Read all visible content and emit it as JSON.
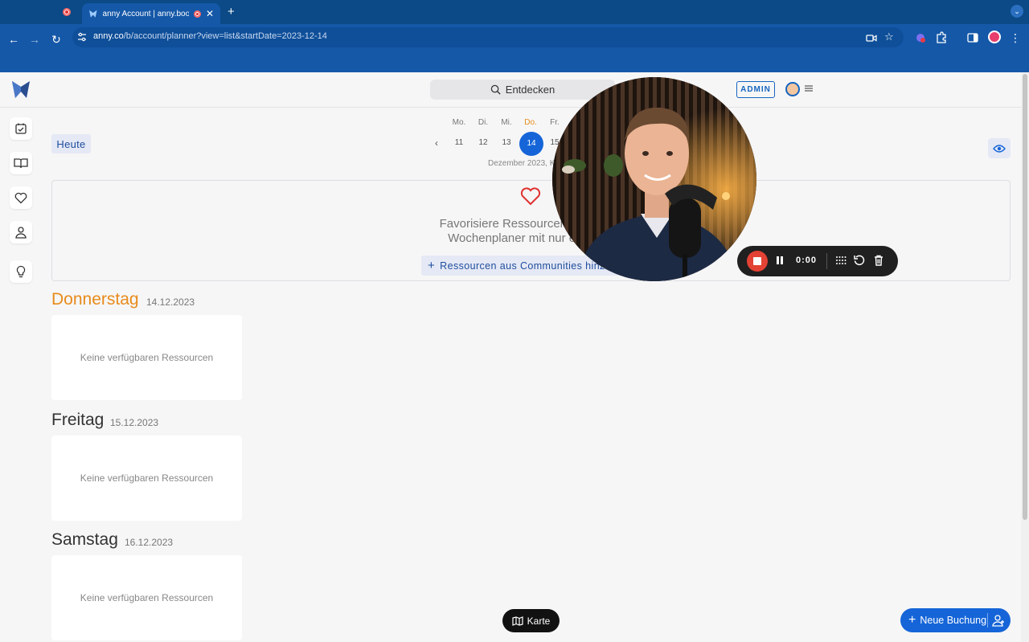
{
  "browser": {
    "tab_title": "anny Account | anny.book",
    "url_host": "anny.co",
    "url_path": "/b/account/planner?view=list&startDate=2023-12-14"
  },
  "header": {
    "search_label": "Entdecken",
    "admin_label": "ADMIN"
  },
  "planner": {
    "today_button": "Heute",
    "weekdays": [
      "Mo.",
      "Di.",
      "Mi.",
      "Do.",
      "Fr."
    ],
    "dates": [
      "11",
      "12",
      "13",
      "14",
      "15"
    ],
    "active_date": "14",
    "month_label": "Dezember 2023, K"
  },
  "favorites": {
    "line1": "Favorisiere Ressourcen, um sie in",
    "line2": "Wochenplaner mit nur einem K",
    "add_button": "Ressourcen aus Communities hinzu"
  },
  "days": [
    {
      "name": "Donnerstag",
      "date": "14.12.2023",
      "empty_text": "Keine verfügbaren Ressourcen"
    },
    {
      "name": "Freitag",
      "date": "15.12.2023",
      "empty_text": "Keine verfügbaren Ressourcen"
    },
    {
      "name": "Samstag",
      "date": "16.12.2023",
      "empty_text": "Keine verfügbaren Ressourcen"
    }
  ],
  "footer": {
    "map_button": "Karte",
    "new_booking_button": "Neue Buchung"
  },
  "recorder": {
    "time": "0:00"
  },
  "colors": {
    "primary": "#1565d8",
    "today_accent": "#e88b1a",
    "chrome": "#1558a8"
  }
}
